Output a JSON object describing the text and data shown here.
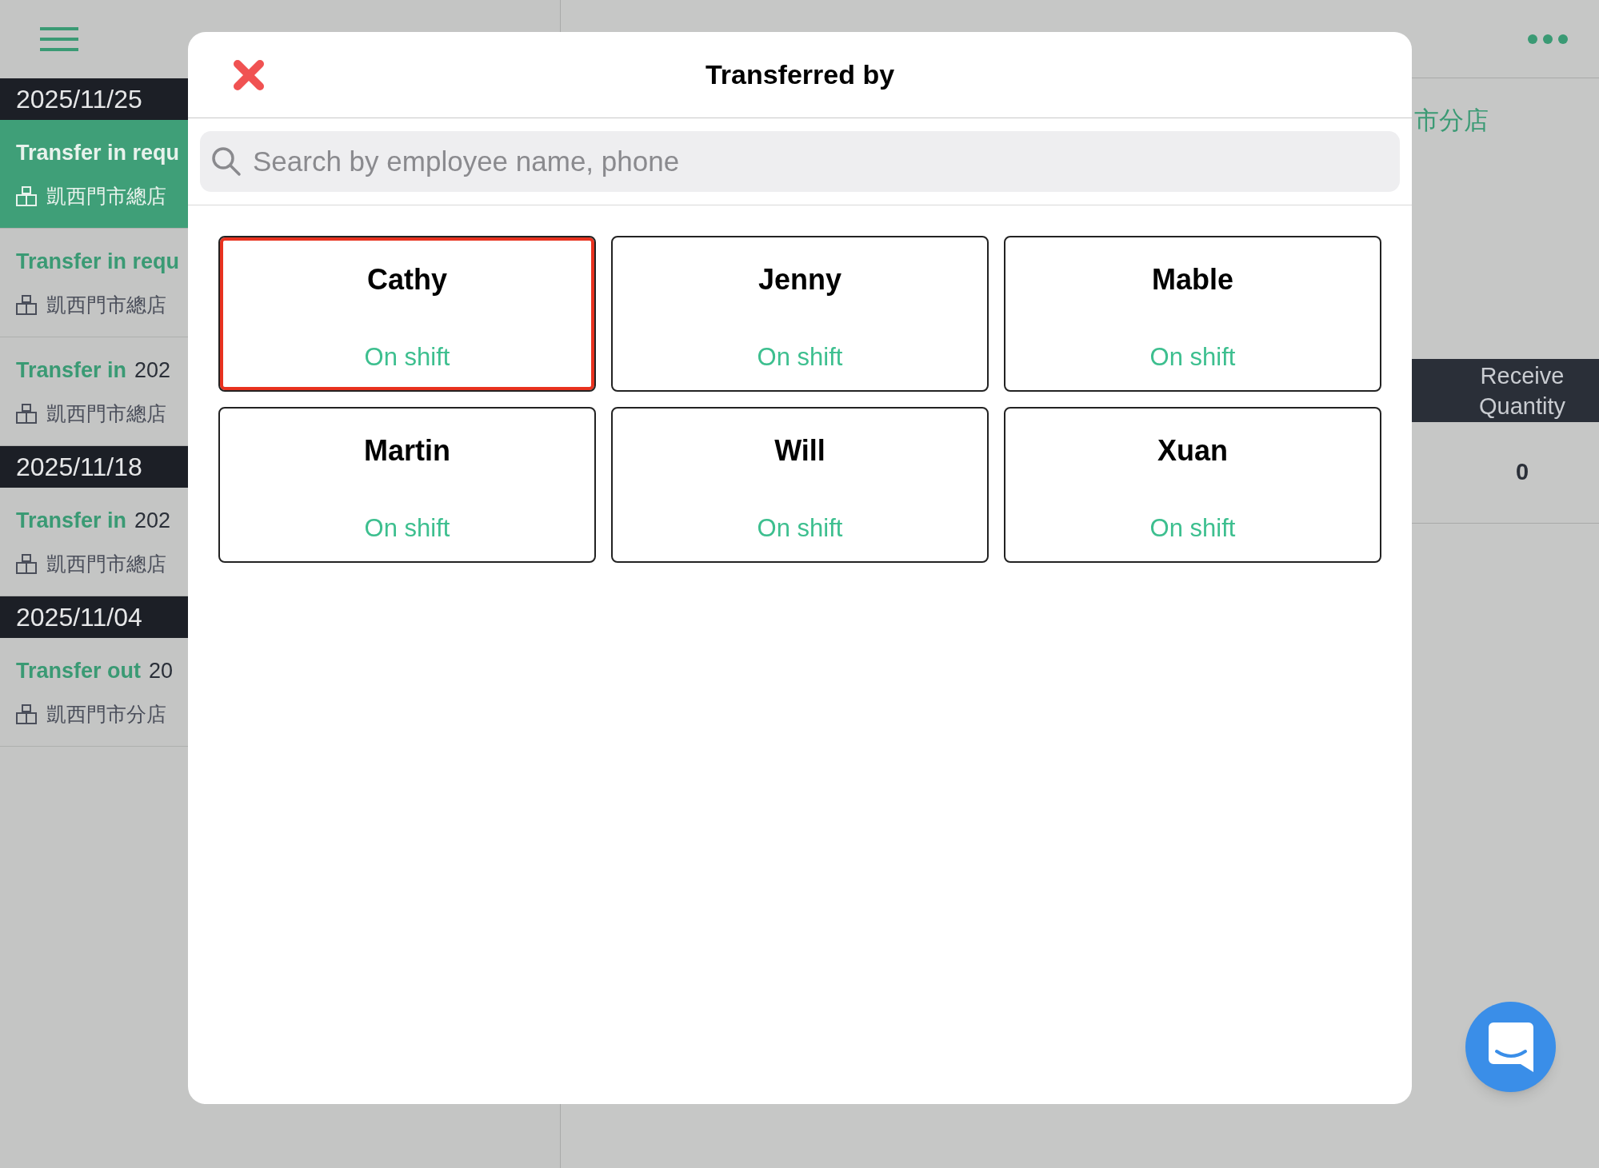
{
  "list_groups": [
    {
      "date": "2025/11/25",
      "items": [
        {
          "type": "Transfer in requ",
          "store": "凱西門市總店",
          "selected": true
        },
        {
          "type": "Transfer in requ",
          "store": "凱西門市總店",
          "selected": false
        },
        {
          "type": "Transfer in",
          "time": "202",
          "store": "凱西門市總店",
          "selected": false
        }
      ]
    },
    {
      "date": "2025/11/18",
      "items": [
        {
          "type": "Transfer in",
          "time": "202",
          "store": "凱西門市總店",
          "selected": false
        }
      ]
    },
    {
      "date": "2025/11/04",
      "items": [
        {
          "type": "Transfer out",
          "time": "20",
          "store": "凱西門市分店",
          "selected": false
        }
      ]
    }
  ],
  "detail": {
    "store": "市分店",
    "column": "Receive Quantity",
    "value": "0"
  },
  "dialog": {
    "title": "Transferred by",
    "search": {
      "placeholder": "Search by employee name, phone"
    },
    "employees": [
      {
        "name": "Cathy",
        "status": "On shift",
        "selected": true
      },
      {
        "name": "Jenny",
        "status": "On shift",
        "selected": false
      },
      {
        "name": "Mable",
        "status": "On shift",
        "selected": false
      },
      {
        "name": "Martin",
        "status": "On shift",
        "selected": false
      },
      {
        "name": "Will",
        "status": "On shift",
        "selected": false
      },
      {
        "name": "Xuan",
        "status": "On shift",
        "selected": false
      }
    ]
  }
}
